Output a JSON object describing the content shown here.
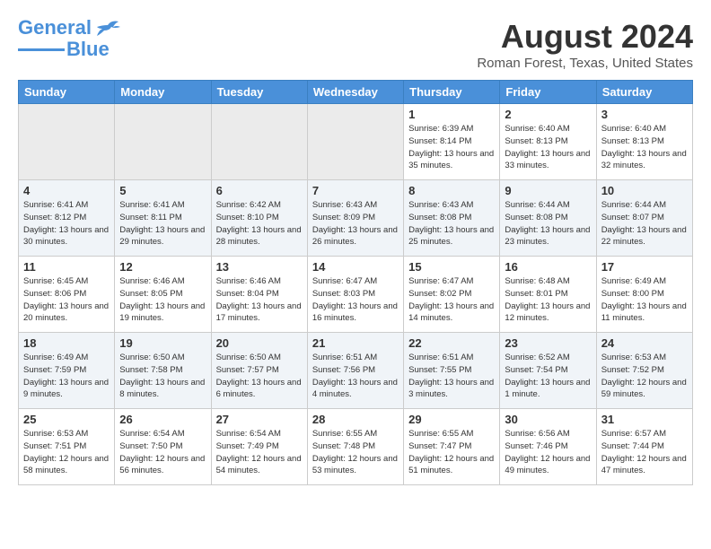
{
  "header": {
    "logo_line1": "General",
    "logo_line2": "Blue",
    "month": "August 2024",
    "location": "Roman Forest, Texas, United States"
  },
  "days_of_week": [
    "Sunday",
    "Monday",
    "Tuesday",
    "Wednesday",
    "Thursday",
    "Friday",
    "Saturday"
  ],
  "weeks": [
    [
      {
        "day": "",
        "empty": true
      },
      {
        "day": "",
        "empty": true
      },
      {
        "day": "",
        "empty": true
      },
      {
        "day": "",
        "empty": true
      },
      {
        "day": "1",
        "sunrise": "6:39 AM",
        "sunset": "8:14 PM",
        "daylight": "13 hours and 35 minutes."
      },
      {
        "day": "2",
        "sunrise": "6:40 AM",
        "sunset": "8:13 PM",
        "daylight": "13 hours and 33 minutes."
      },
      {
        "day": "3",
        "sunrise": "6:40 AM",
        "sunset": "8:13 PM",
        "daylight": "13 hours and 32 minutes."
      }
    ],
    [
      {
        "day": "4",
        "sunrise": "6:41 AM",
        "sunset": "8:12 PM",
        "daylight": "13 hours and 30 minutes."
      },
      {
        "day": "5",
        "sunrise": "6:41 AM",
        "sunset": "8:11 PM",
        "daylight": "13 hours and 29 minutes."
      },
      {
        "day": "6",
        "sunrise": "6:42 AM",
        "sunset": "8:10 PM",
        "daylight": "13 hours and 28 minutes."
      },
      {
        "day": "7",
        "sunrise": "6:43 AM",
        "sunset": "8:09 PM",
        "daylight": "13 hours and 26 minutes."
      },
      {
        "day": "8",
        "sunrise": "6:43 AM",
        "sunset": "8:08 PM",
        "daylight": "13 hours and 25 minutes."
      },
      {
        "day": "9",
        "sunrise": "6:44 AM",
        "sunset": "8:08 PM",
        "daylight": "13 hours and 23 minutes."
      },
      {
        "day": "10",
        "sunrise": "6:44 AM",
        "sunset": "8:07 PM",
        "daylight": "13 hours and 22 minutes."
      }
    ],
    [
      {
        "day": "11",
        "sunrise": "6:45 AM",
        "sunset": "8:06 PM",
        "daylight": "13 hours and 20 minutes."
      },
      {
        "day": "12",
        "sunrise": "6:46 AM",
        "sunset": "8:05 PM",
        "daylight": "13 hours and 19 minutes."
      },
      {
        "day": "13",
        "sunrise": "6:46 AM",
        "sunset": "8:04 PM",
        "daylight": "13 hours and 17 minutes."
      },
      {
        "day": "14",
        "sunrise": "6:47 AM",
        "sunset": "8:03 PM",
        "daylight": "13 hours and 16 minutes."
      },
      {
        "day": "15",
        "sunrise": "6:47 AM",
        "sunset": "8:02 PM",
        "daylight": "13 hours and 14 minutes."
      },
      {
        "day": "16",
        "sunrise": "6:48 AM",
        "sunset": "8:01 PM",
        "daylight": "13 hours and 12 minutes."
      },
      {
        "day": "17",
        "sunrise": "6:49 AM",
        "sunset": "8:00 PM",
        "daylight": "13 hours and 11 minutes."
      }
    ],
    [
      {
        "day": "18",
        "sunrise": "6:49 AM",
        "sunset": "7:59 PM",
        "daylight": "13 hours and 9 minutes."
      },
      {
        "day": "19",
        "sunrise": "6:50 AM",
        "sunset": "7:58 PM",
        "daylight": "13 hours and 8 minutes."
      },
      {
        "day": "20",
        "sunrise": "6:50 AM",
        "sunset": "7:57 PM",
        "daylight": "13 hours and 6 minutes."
      },
      {
        "day": "21",
        "sunrise": "6:51 AM",
        "sunset": "7:56 PM",
        "daylight": "13 hours and 4 minutes."
      },
      {
        "day": "22",
        "sunrise": "6:51 AM",
        "sunset": "7:55 PM",
        "daylight": "13 hours and 3 minutes."
      },
      {
        "day": "23",
        "sunrise": "6:52 AM",
        "sunset": "7:54 PM",
        "daylight": "13 hours and 1 minute."
      },
      {
        "day": "24",
        "sunrise": "6:53 AM",
        "sunset": "7:52 PM",
        "daylight": "12 hours and 59 minutes."
      }
    ],
    [
      {
        "day": "25",
        "sunrise": "6:53 AM",
        "sunset": "7:51 PM",
        "daylight": "12 hours and 58 minutes."
      },
      {
        "day": "26",
        "sunrise": "6:54 AM",
        "sunset": "7:50 PM",
        "daylight": "12 hours and 56 minutes."
      },
      {
        "day": "27",
        "sunrise": "6:54 AM",
        "sunset": "7:49 PM",
        "daylight": "12 hours and 54 minutes."
      },
      {
        "day": "28",
        "sunrise": "6:55 AM",
        "sunset": "7:48 PM",
        "daylight": "12 hours and 53 minutes."
      },
      {
        "day": "29",
        "sunrise": "6:55 AM",
        "sunset": "7:47 PM",
        "daylight": "12 hours and 51 minutes."
      },
      {
        "day": "30",
        "sunrise": "6:56 AM",
        "sunset": "7:46 PM",
        "daylight": "12 hours and 49 minutes."
      },
      {
        "day": "31",
        "sunrise": "6:57 AM",
        "sunset": "7:44 PM",
        "daylight": "12 hours and 47 minutes."
      }
    ]
  ]
}
